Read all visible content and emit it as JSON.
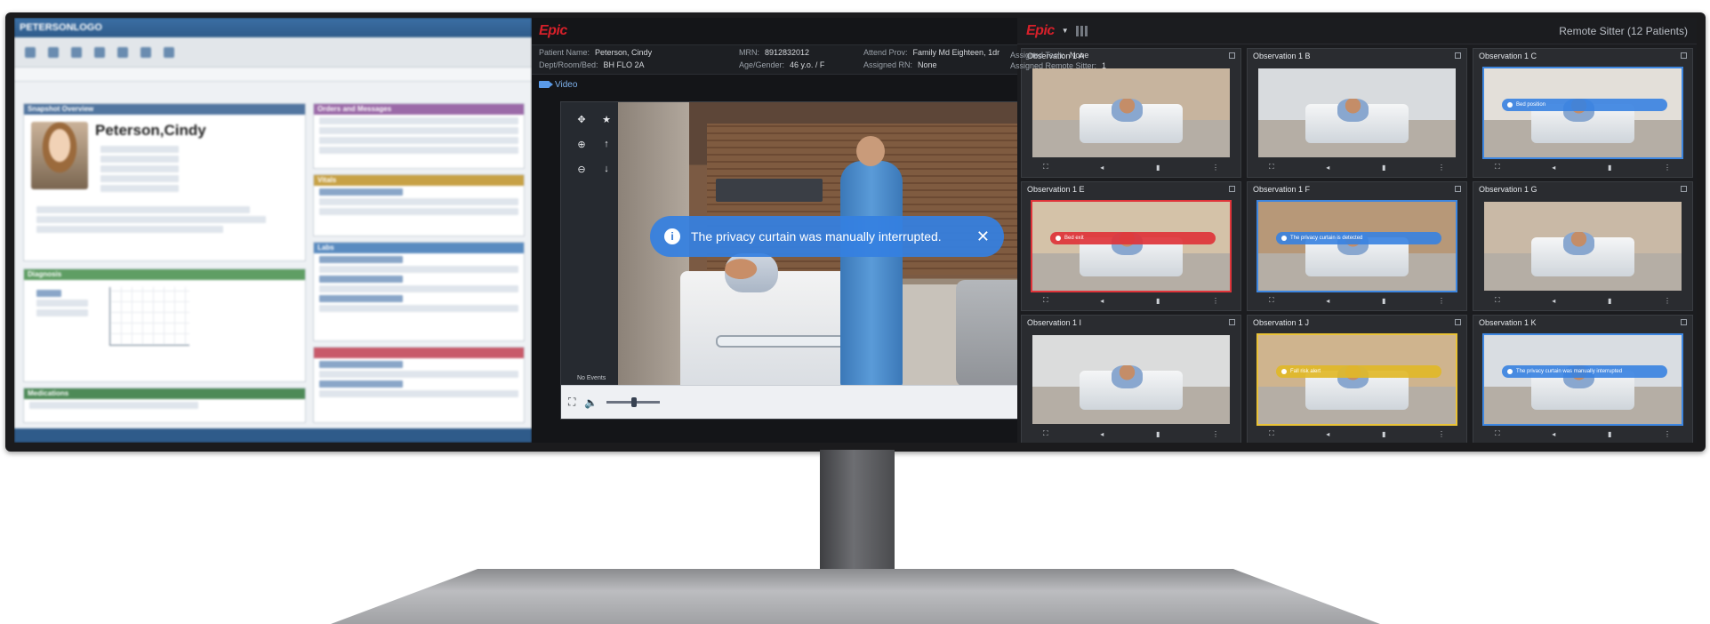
{
  "left_panel": {
    "app_brand": "PETERSONLOGO",
    "patient_name": "Peterson,Cindy",
    "sections": [
      "Snapshot Overview",
      "Orders and Messages",
      "Vitals",
      "Labs",
      "Diagnosis",
      "Medications"
    ]
  },
  "middle_panel": {
    "brand": "Epic",
    "patient_info": {
      "patient_name_label": "Patient Name:",
      "patient_name": "Peterson, Cindy",
      "dept_label": "Dept/Room/Bed:",
      "dept": "BH FLO 2A",
      "mrn_label": "MRN:",
      "mrn": "8912832012",
      "age_label": "Age/Gender:",
      "age": "46 y.o. / F",
      "attend_label": "Attend Prov:",
      "attend": "Family Md Eighteen, 1dr",
      "rn_label": "Assigned RN:",
      "rn": "None",
      "tech_label": "Assigned Tech:",
      "tech": "None",
      "remote_label": "Assigned Remote Sitter:",
      "remote": "1"
    },
    "video_tab": "Video",
    "banner_message": "The privacy curtain was manually interrupted.",
    "no_events": "No Events",
    "ptz_icons": [
      "move-icon",
      "star-icon",
      "zoom-in-icon",
      "up-icon",
      "zoom-out-icon",
      "down-icon"
    ]
  },
  "right_panel": {
    "brand": "Epic",
    "title": "Remote Sitter (12 Patients)",
    "tiles": [
      {
        "name": "Observation 1 A",
        "alert": "",
        "color": "none",
        "wall": "#c7b49e"
      },
      {
        "name": "Observation 1 B",
        "alert": "",
        "color": "none",
        "wall": "#d8dbde"
      },
      {
        "name": "Observation 1 C",
        "alert": "Bed position",
        "color": "blue",
        "wall": "#e3dfd9"
      },
      {
        "name": "Observation 1 E",
        "alert": "Bed exit",
        "color": "red",
        "wall": "#d4c2a8"
      },
      {
        "name": "Observation 1 F",
        "alert": "The privacy curtain is detected",
        "color": "blue",
        "wall": "#b79878"
      },
      {
        "name": "Observation 1 G",
        "alert": "",
        "color": "none",
        "wall": "#c9b9a6"
      },
      {
        "name": "Observation 1 I",
        "alert": "",
        "color": "none",
        "wall": "#dbdcdc"
      },
      {
        "name": "Observation 1 J",
        "alert": "Fall risk alert",
        "color": "yellow",
        "wall": "#cfb48e"
      },
      {
        "name": "Observation 1 K",
        "alert": "The privacy curtain was manually interrupted",
        "color": "blue",
        "wall": "#d9dde2"
      }
    ]
  }
}
